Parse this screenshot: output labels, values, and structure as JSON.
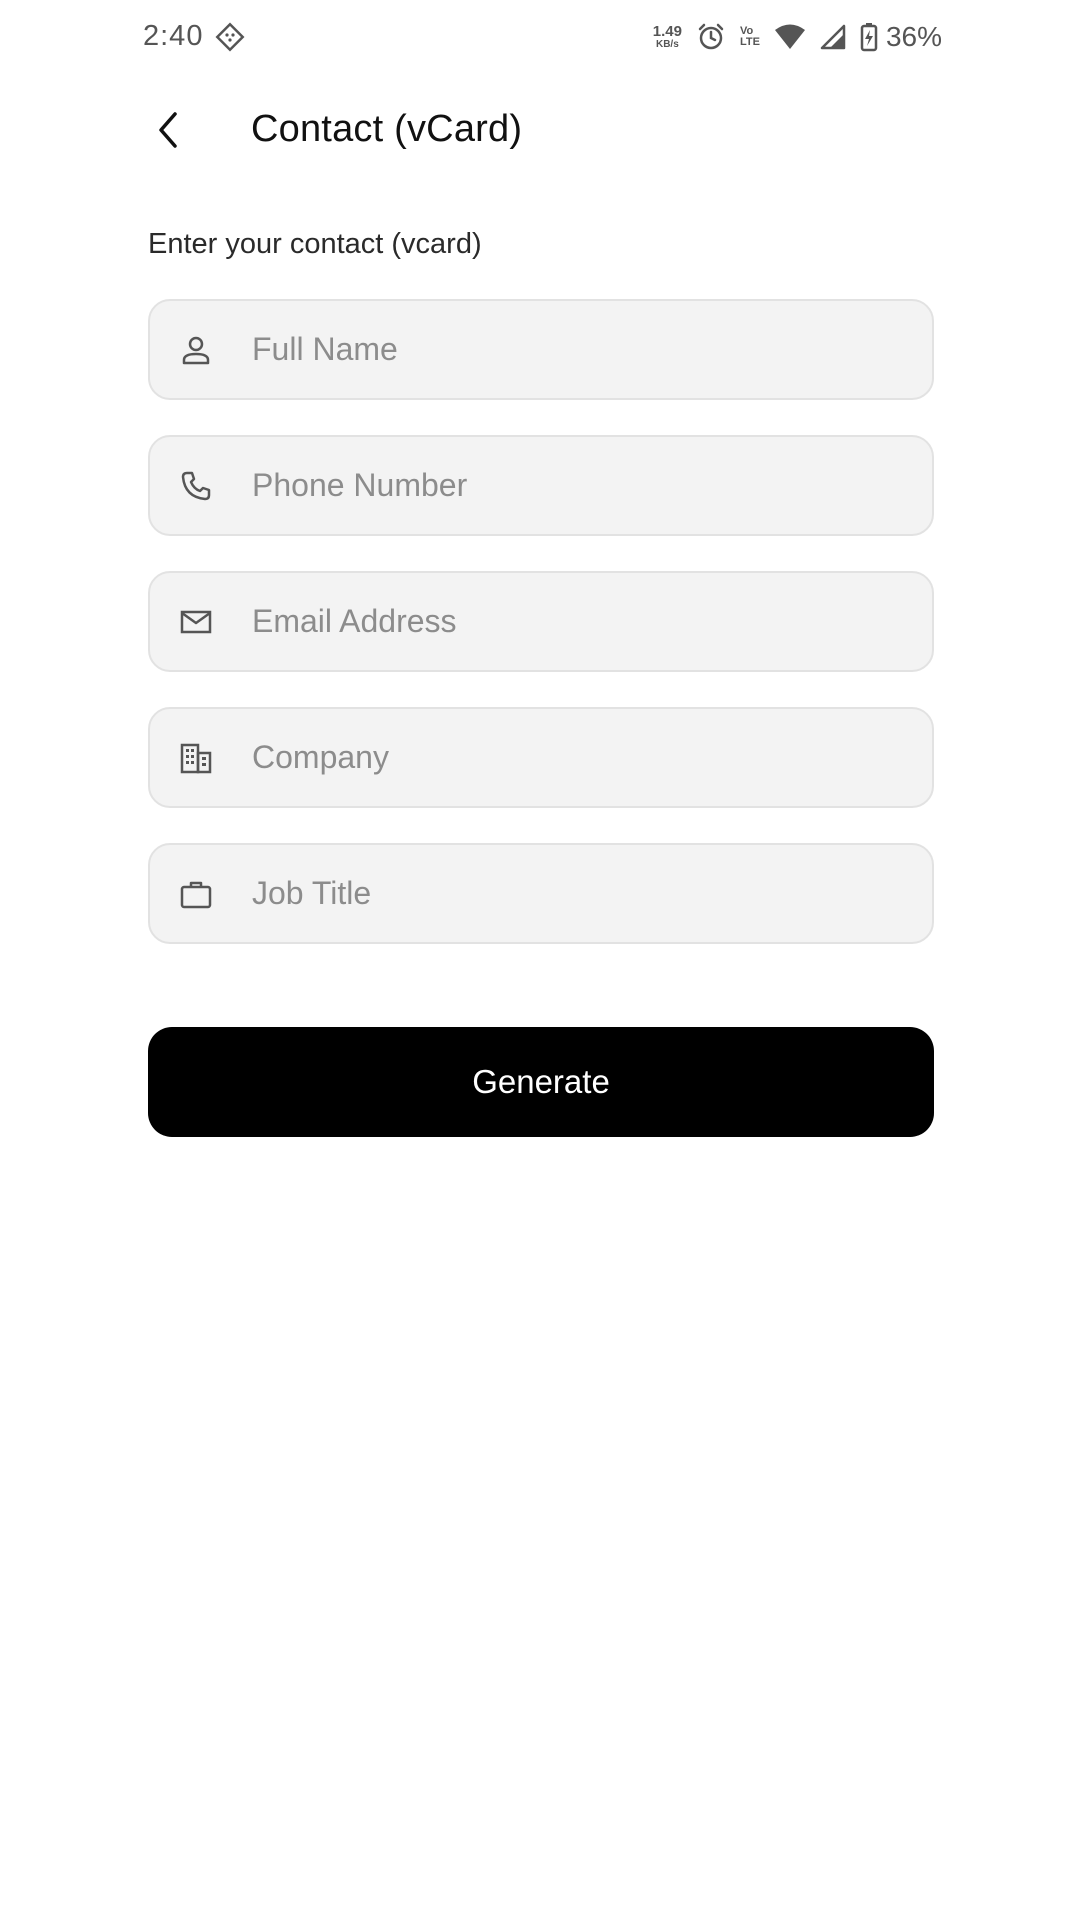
{
  "status_bar": {
    "time": "2:40",
    "net_speed_value": "1.49",
    "net_speed_unit": "KB/s",
    "volte_top": "Vo",
    "volte_bottom": "LTE",
    "battery_percent": "36%"
  },
  "header": {
    "title": "Contact (vCard)"
  },
  "form": {
    "intro": "Enter your contact (vcard)",
    "fields": [
      {
        "icon": "person-icon",
        "placeholder": "Full Name",
        "value": ""
      },
      {
        "icon": "phone-icon",
        "placeholder": "Phone Number",
        "value": ""
      },
      {
        "icon": "mail-icon",
        "placeholder": "Email Address",
        "value": ""
      },
      {
        "icon": "building-icon",
        "placeholder": "Company",
        "value": ""
      },
      {
        "icon": "briefcase-icon",
        "placeholder": "Job Title",
        "value": ""
      }
    ],
    "submit_label": "Generate"
  },
  "colors": {
    "field_background": "#f3f3f3",
    "field_border": "#e2e2e2",
    "button_background": "#000000",
    "button_text": "#ffffff",
    "placeholder": "#8c8c8c"
  }
}
